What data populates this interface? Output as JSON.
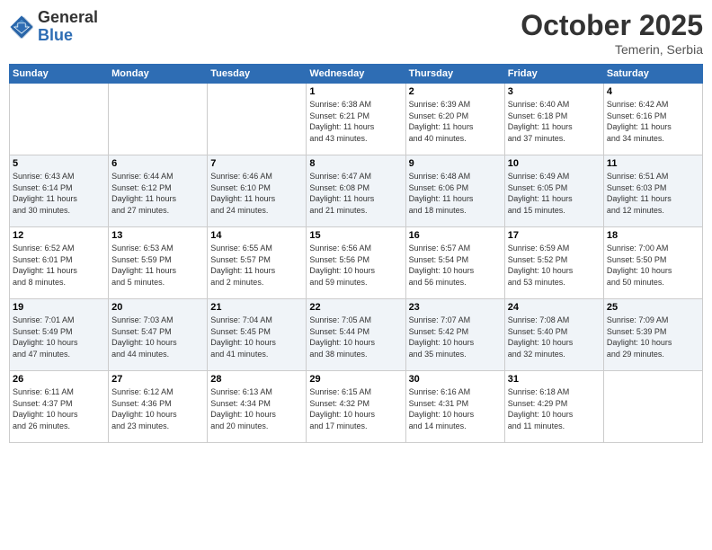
{
  "logo": {
    "general": "General",
    "blue": "Blue"
  },
  "title": "October 2025",
  "location": "Temerin, Serbia",
  "days_header": [
    "Sunday",
    "Monday",
    "Tuesday",
    "Wednesday",
    "Thursday",
    "Friday",
    "Saturday"
  ],
  "weeks": [
    [
      {
        "day": "",
        "info": ""
      },
      {
        "day": "",
        "info": ""
      },
      {
        "day": "",
        "info": ""
      },
      {
        "day": "1",
        "info": "Sunrise: 6:38 AM\nSunset: 6:21 PM\nDaylight: 11 hours\nand 43 minutes."
      },
      {
        "day": "2",
        "info": "Sunrise: 6:39 AM\nSunset: 6:20 PM\nDaylight: 11 hours\nand 40 minutes."
      },
      {
        "day": "3",
        "info": "Sunrise: 6:40 AM\nSunset: 6:18 PM\nDaylight: 11 hours\nand 37 minutes."
      },
      {
        "day": "4",
        "info": "Sunrise: 6:42 AM\nSunset: 6:16 PM\nDaylight: 11 hours\nand 34 minutes."
      }
    ],
    [
      {
        "day": "5",
        "info": "Sunrise: 6:43 AM\nSunset: 6:14 PM\nDaylight: 11 hours\nand 30 minutes."
      },
      {
        "day": "6",
        "info": "Sunrise: 6:44 AM\nSunset: 6:12 PM\nDaylight: 11 hours\nand 27 minutes."
      },
      {
        "day": "7",
        "info": "Sunrise: 6:46 AM\nSunset: 6:10 PM\nDaylight: 11 hours\nand 24 minutes."
      },
      {
        "day": "8",
        "info": "Sunrise: 6:47 AM\nSunset: 6:08 PM\nDaylight: 11 hours\nand 21 minutes."
      },
      {
        "day": "9",
        "info": "Sunrise: 6:48 AM\nSunset: 6:06 PM\nDaylight: 11 hours\nand 18 minutes."
      },
      {
        "day": "10",
        "info": "Sunrise: 6:49 AM\nSunset: 6:05 PM\nDaylight: 11 hours\nand 15 minutes."
      },
      {
        "day": "11",
        "info": "Sunrise: 6:51 AM\nSunset: 6:03 PM\nDaylight: 11 hours\nand 12 minutes."
      }
    ],
    [
      {
        "day": "12",
        "info": "Sunrise: 6:52 AM\nSunset: 6:01 PM\nDaylight: 11 hours\nand 8 minutes."
      },
      {
        "day": "13",
        "info": "Sunrise: 6:53 AM\nSunset: 5:59 PM\nDaylight: 11 hours\nand 5 minutes."
      },
      {
        "day": "14",
        "info": "Sunrise: 6:55 AM\nSunset: 5:57 PM\nDaylight: 11 hours\nand 2 minutes."
      },
      {
        "day": "15",
        "info": "Sunrise: 6:56 AM\nSunset: 5:56 PM\nDaylight: 10 hours\nand 59 minutes."
      },
      {
        "day": "16",
        "info": "Sunrise: 6:57 AM\nSunset: 5:54 PM\nDaylight: 10 hours\nand 56 minutes."
      },
      {
        "day": "17",
        "info": "Sunrise: 6:59 AM\nSunset: 5:52 PM\nDaylight: 10 hours\nand 53 minutes."
      },
      {
        "day": "18",
        "info": "Sunrise: 7:00 AM\nSunset: 5:50 PM\nDaylight: 10 hours\nand 50 minutes."
      }
    ],
    [
      {
        "day": "19",
        "info": "Sunrise: 7:01 AM\nSunset: 5:49 PM\nDaylight: 10 hours\nand 47 minutes."
      },
      {
        "day": "20",
        "info": "Sunrise: 7:03 AM\nSunset: 5:47 PM\nDaylight: 10 hours\nand 44 minutes."
      },
      {
        "day": "21",
        "info": "Sunrise: 7:04 AM\nSunset: 5:45 PM\nDaylight: 10 hours\nand 41 minutes."
      },
      {
        "day": "22",
        "info": "Sunrise: 7:05 AM\nSunset: 5:44 PM\nDaylight: 10 hours\nand 38 minutes."
      },
      {
        "day": "23",
        "info": "Sunrise: 7:07 AM\nSunset: 5:42 PM\nDaylight: 10 hours\nand 35 minutes."
      },
      {
        "day": "24",
        "info": "Sunrise: 7:08 AM\nSunset: 5:40 PM\nDaylight: 10 hours\nand 32 minutes."
      },
      {
        "day": "25",
        "info": "Sunrise: 7:09 AM\nSunset: 5:39 PM\nDaylight: 10 hours\nand 29 minutes."
      }
    ],
    [
      {
        "day": "26",
        "info": "Sunrise: 6:11 AM\nSunset: 4:37 PM\nDaylight: 10 hours\nand 26 minutes."
      },
      {
        "day": "27",
        "info": "Sunrise: 6:12 AM\nSunset: 4:36 PM\nDaylight: 10 hours\nand 23 minutes."
      },
      {
        "day": "28",
        "info": "Sunrise: 6:13 AM\nSunset: 4:34 PM\nDaylight: 10 hours\nand 20 minutes."
      },
      {
        "day": "29",
        "info": "Sunrise: 6:15 AM\nSunset: 4:32 PM\nDaylight: 10 hours\nand 17 minutes."
      },
      {
        "day": "30",
        "info": "Sunrise: 6:16 AM\nSunset: 4:31 PM\nDaylight: 10 hours\nand 14 minutes."
      },
      {
        "day": "31",
        "info": "Sunrise: 6:18 AM\nSunset: 4:29 PM\nDaylight: 10 hours\nand 11 minutes."
      },
      {
        "day": "",
        "info": ""
      }
    ]
  ]
}
